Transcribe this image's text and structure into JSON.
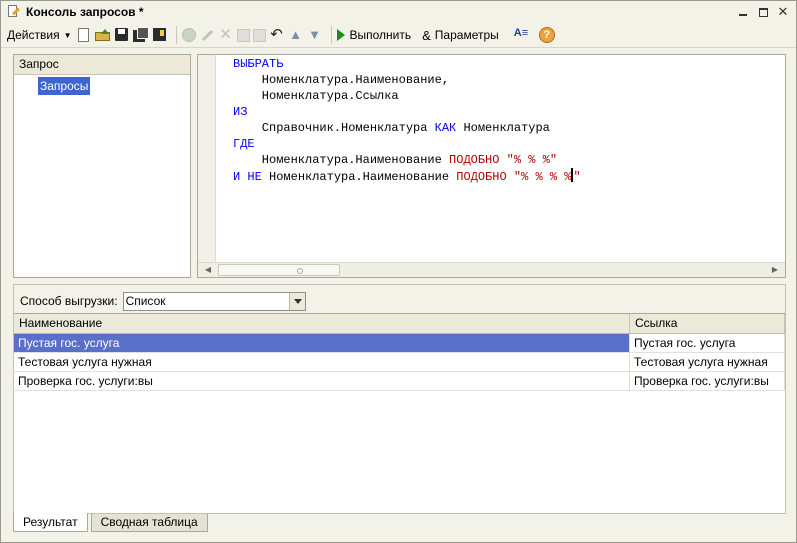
{
  "window": {
    "title": "Консоль запросов *"
  },
  "toolbar": {
    "actions_label": "Действия",
    "execute_label": "Выполнить",
    "params_label": "Параметры",
    "help_symbol": "?"
  },
  "tree": {
    "header": "Запрос",
    "items": [
      {
        "label": "Запросы",
        "selected": true
      }
    ]
  },
  "editor": {
    "lines": [
      [
        {
          "t": "ВЫБРАТЬ",
          "c": "kw"
        }
      ],
      [
        {
          "t": "    Номенклатура.Наименование,",
          "c": ""
        }
      ],
      [
        {
          "t": "    Номенклатура.Ссылка",
          "c": ""
        }
      ],
      [
        {
          "t": "ИЗ",
          "c": "kw"
        }
      ],
      [
        {
          "t": "    Справочник.Номенклатура ",
          "c": ""
        },
        {
          "t": "КАК",
          "c": "kw"
        },
        {
          "t": " Номенклатура",
          "c": ""
        }
      ],
      [
        {
          "t": "ГДЕ",
          "c": "kw"
        }
      ],
      [
        {
          "t": "    Номенклатура.Наименование ",
          "c": ""
        },
        {
          "t": "ПОДОБНО",
          "c": "op"
        },
        {
          "t": " \"% % %\"",
          "c": "str"
        }
      ],
      [
        {
          "t": "И НЕ",
          "c": "kw"
        },
        {
          "t": " Номенклатура.Наименование ",
          "c": ""
        },
        {
          "t": "ПОДОБНО",
          "c": "op"
        },
        {
          "t": " \"% % % %\"",
          "c": "str"
        }
      ]
    ]
  },
  "results": {
    "upload_label": "Способ выгрузки:",
    "upload_value": "Список",
    "columns": [
      "Наименование",
      "Ссылка"
    ],
    "rows": [
      [
        "Пустая гос. услуга",
        "Пустая гос. услуга"
      ],
      [
        "Тестовая услуга нужная",
        "Тестовая услуга нужная"
      ],
      [
        "Проверка гос. услуги:вы",
        "Проверка гос. услуги:вы"
      ]
    ],
    "selected_row": 0
  },
  "tabs": [
    {
      "label": "Результат",
      "active": true
    },
    {
      "label": "Сводная таблица",
      "active": false
    }
  ]
}
